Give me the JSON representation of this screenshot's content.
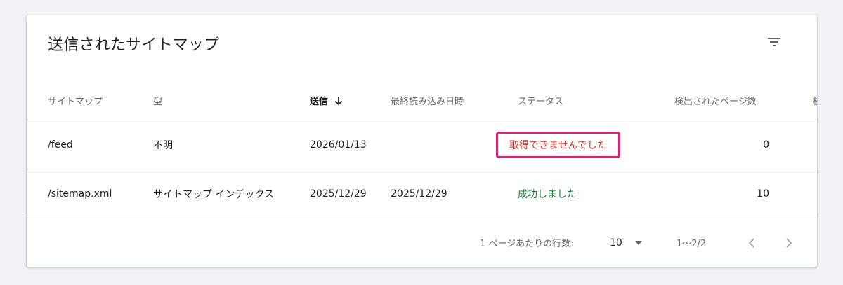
{
  "title": "送信されたサイトマップ",
  "columns": {
    "sitemap": "サイトマップ",
    "type": "型",
    "sent": "送信",
    "last_read": "最終読み込み日時",
    "status": "ステータス",
    "found_pages": "検出されたページ数",
    "extra": "検"
  },
  "rows": [
    {
      "sitemap": "/feed",
      "type": "不明",
      "sent": "2026/01/13",
      "last_read": "",
      "status": "取得できませんでした",
      "found_pages": "0"
    },
    {
      "sitemap": "/sitemap.xml",
      "type": "サイトマップ インデックス",
      "sent": "2025/12/29",
      "last_read": "2025/12/29",
      "status": "成功しました",
      "found_pages": "10"
    }
  ],
  "pagination": {
    "rows_per_page_label": "1 ページあたりの行数:",
    "rows_per_page_value": "10",
    "range": "1〜2/2"
  },
  "colors": {
    "error_text": "#d93025",
    "error_border": "#d6246e",
    "success_text": "#188038",
    "background": "#f1f3f6"
  }
}
